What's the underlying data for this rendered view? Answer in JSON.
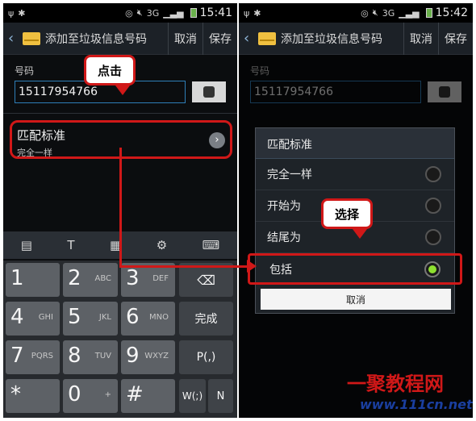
{
  "left": {
    "status": {
      "icons": [
        "usb-icon",
        "bluetooth-icon",
        "eye-icon",
        "mute-icon",
        "3g-icon",
        "signal-icon",
        "battery-icon"
      ],
      "network": "3G",
      "time": "15:41"
    },
    "appbar": {
      "title": "添加至垃圾信息号码",
      "cancel": "取消",
      "save": "保存"
    },
    "number_label": "号码",
    "number_value": "15117954766",
    "match": {
      "title": "匹配标准",
      "value": "完全一样"
    },
    "keyboard": {
      "rows": [
        [
          {
            "big": "1",
            "small": ""
          },
          {
            "big": "2",
            "small": "ABC"
          },
          {
            "big": "3",
            "small": "DEF"
          },
          {
            "big": "⌫",
            "small": ""
          }
        ],
        [
          {
            "big": "4",
            "small": "GHI"
          },
          {
            "big": "5",
            "small": "JKL"
          },
          {
            "big": "6",
            "small": "MNO"
          },
          {
            "big": "完成",
            "small": ""
          }
        ],
        [
          {
            "big": "7",
            "small": "PQRS"
          },
          {
            "big": "8",
            "small": "TUV"
          },
          {
            "big": "9",
            "small": "WXYZ"
          },
          {
            "big": "P(,)",
            "small": ""
          }
        ],
        [
          {
            "big": "*",
            "small": ""
          },
          {
            "big": "0",
            "small": "+"
          },
          {
            "big": "#",
            "small": ""
          },
          {
            "big": "W(;)",
            "small": ""
          },
          {
            "big": "N",
            "small": ""
          }
        ]
      ]
    },
    "callout": "点击"
  },
  "right": {
    "status": {
      "network": "3G",
      "time": "15:42"
    },
    "appbar": {
      "title": "添加至垃圾信息号码",
      "cancel": "取消",
      "save": "保存"
    },
    "number_label": "号码",
    "number_value": "15117954766",
    "dialog": {
      "title": "匹配标准",
      "options": [
        {
          "label": "完全一样",
          "selected": false
        },
        {
          "label": "开始为",
          "selected": false
        },
        {
          "label": "结尾为",
          "selected": false
        },
        {
          "label": "包括",
          "selected": true
        }
      ],
      "cancel": "取消"
    },
    "callout": "选择"
  },
  "watermark": {
    "line1": "一聚教程网",
    "line2": "www.111cn.net"
  }
}
